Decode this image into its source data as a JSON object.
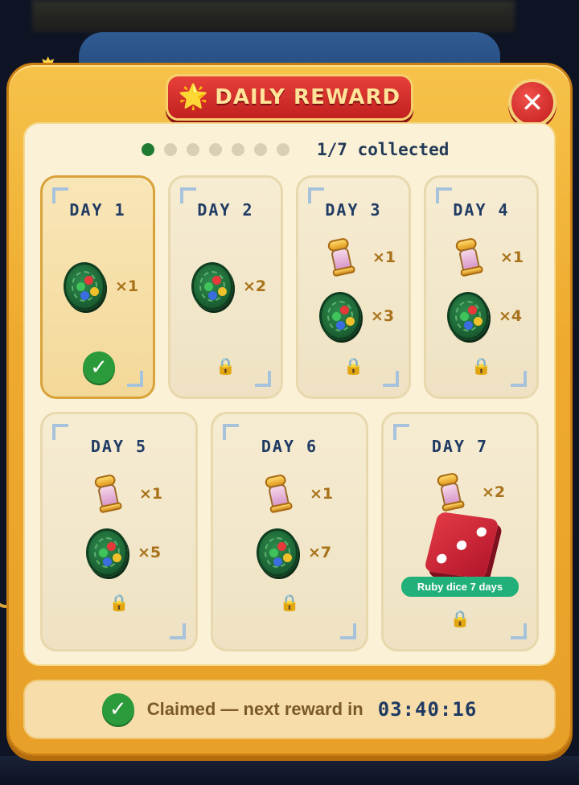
{
  "header": {
    "title": "DAILY REWARD",
    "title_icon": "star-icon",
    "close_icon": "close-icon",
    "close_label": "✕"
  },
  "progress": {
    "total_days": 7,
    "collected": 1,
    "text": "1/7 collected"
  },
  "days": [
    {
      "label": "DAY 1",
      "status": "claimed",
      "items": [
        {
          "icon": "green-coin-icon",
          "qty": "×1"
        }
      ]
    },
    {
      "label": "DAY 2",
      "status": "locked",
      "items": [
        {
          "icon": "green-coin-icon",
          "qty": "×2"
        }
      ]
    },
    {
      "label": "DAY 3",
      "status": "locked",
      "items": [
        {
          "icon": "potion-icon",
          "qty": "×1"
        },
        {
          "icon": "green-coin-icon",
          "qty": "×3"
        }
      ]
    },
    {
      "label": "DAY 4",
      "status": "locked",
      "items": [
        {
          "icon": "potion-icon",
          "qty": "×1"
        },
        {
          "icon": "green-coin-icon",
          "qty": "×4"
        }
      ]
    },
    {
      "label": "DAY 5",
      "status": "locked",
      "items": [
        {
          "icon": "potion-icon",
          "qty": "×1"
        },
        {
          "icon": "green-coin-icon",
          "qty": "×5"
        }
      ]
    },
    {
      "label": "DAY 6",
      "status": "locked",
      "items": [
        {
          "icon": "potion-icon",
          "qty": "×1"
        },
        {
          "icon": "green-coin-icon",
          "qty": "×7"
        }
      ]
    },
    {
      "label": "DAY 7",
      "status": "locked",
      "items": [
        {
          "icon": "potion-icon",
          "qty": "×2"
        },
        {
          "icon": "ruby-dice-icon"
        }
      ],
      "special_label": "Ruby dice 7 days"
    }
  ],
  "footer": {
    "status_text": "Claimed — next reward in",
    "timer": "03:40:16"
  },
  "glyphs": {
    "check": "✓",
    "lock": "🔒",
    "star": "🌟"
  },
  "colors": {
    "modal": "#eeaa2e",
    "title_banner": "#c1211f",
    "progress_active": "#1f7a33",
    "claim_green": "#2b9a3a",
    "day_label": "#1f3a63",
    "qty_text": "#a8721a",
    "ribbon": "#22b07a"
  }
}
